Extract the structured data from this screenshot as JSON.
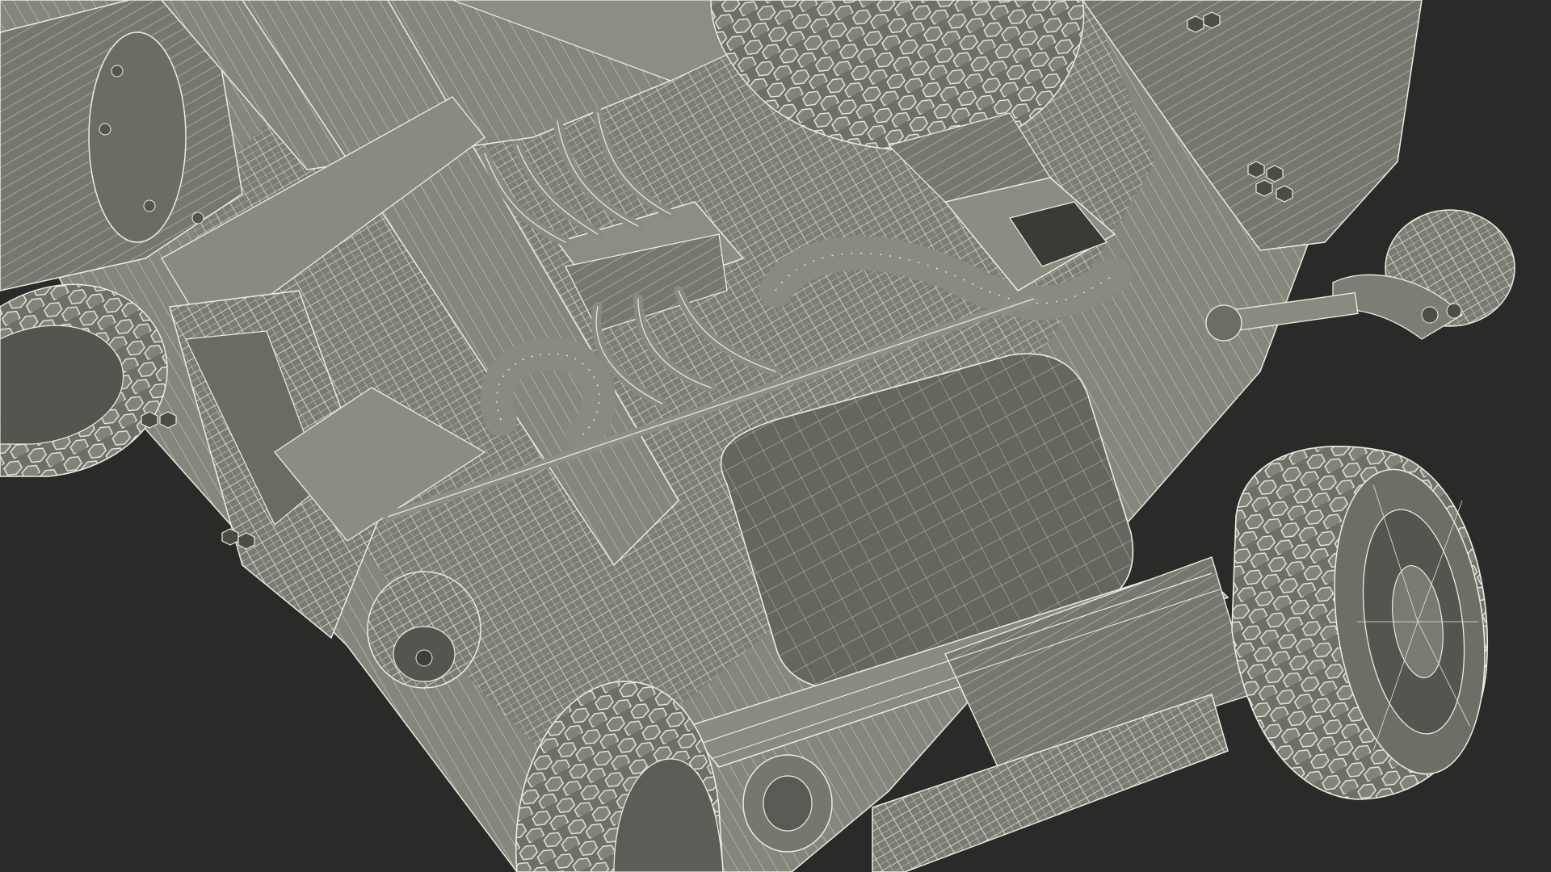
{
  "scene": {
    "subject": "vehicle-undercarriage-wireframe",
    "render_style": "wireframe",
    "colors": {
      "background": "#2a2a29",
      "surface_light": "#8b8b82",
      "surface_mid": "#6d6d66",
      "surface_dark": "#4e4e49",
      "wire": "#e9e9de"
    },
    "visible_text": []
  }
}
